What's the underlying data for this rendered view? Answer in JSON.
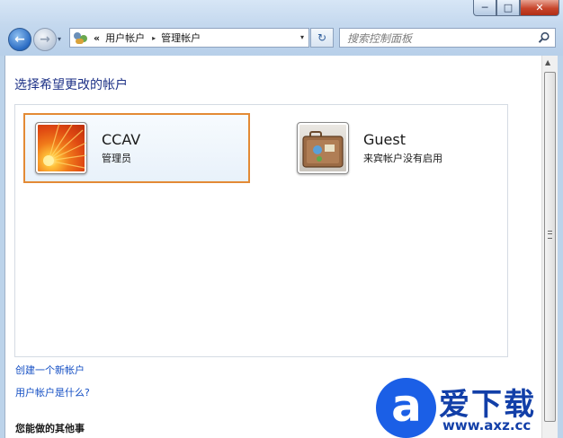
{
  "window": {
    "caption_buttons": {
      "minimize": "─",
      "maximize": "□",
      "close": "✕"
    }
  },
  "navbar": {
    "back_glyph": "←",
    "forward_glyph": "→",
    "history_glyph": "▾",
    "breadcrumb": {
      "overflow": "«",
      "items": [
        "用户帐户",
        "管理帐户"
      ],
      "separator": "▸"
    },
    "address_dropdown_glyph": "▾",
    "refresh_glyph": "↻",
    "search_placeholder": "搜索控制面板"
  },
  "main": {
    "heading": "选择希望更改的帐户",
    "accounts": [
      {
        "name": "CCAV",
        "description": "管理员",
        "icon": "flower-avatar-icon",
        "selected": true
      },
      {
        "name": "Guest",
        "description": "来宾帐户没有启用",
        "icon": "suitcase-avatar-icon",
        "selected": false
      }
    ],
    "links": {
      "create": "创建一个新帐户",
      "what": "用户帐户是什么?"
    },
    "other_heading": "您能做的其他事"
  },
  "scrollbar": {
    "up_glyph": "▲"
  },
  "watermark": {
    "letter": "a",
    "title": "爱下载",
    "url": "www.axz.cc"
  },
  "colors": {
    "heading": "#1e3287",
    "link": "#1650c4",
    "selection_border": "#e38a35",
    "watermark": "#1b5fe6"
  }
}
